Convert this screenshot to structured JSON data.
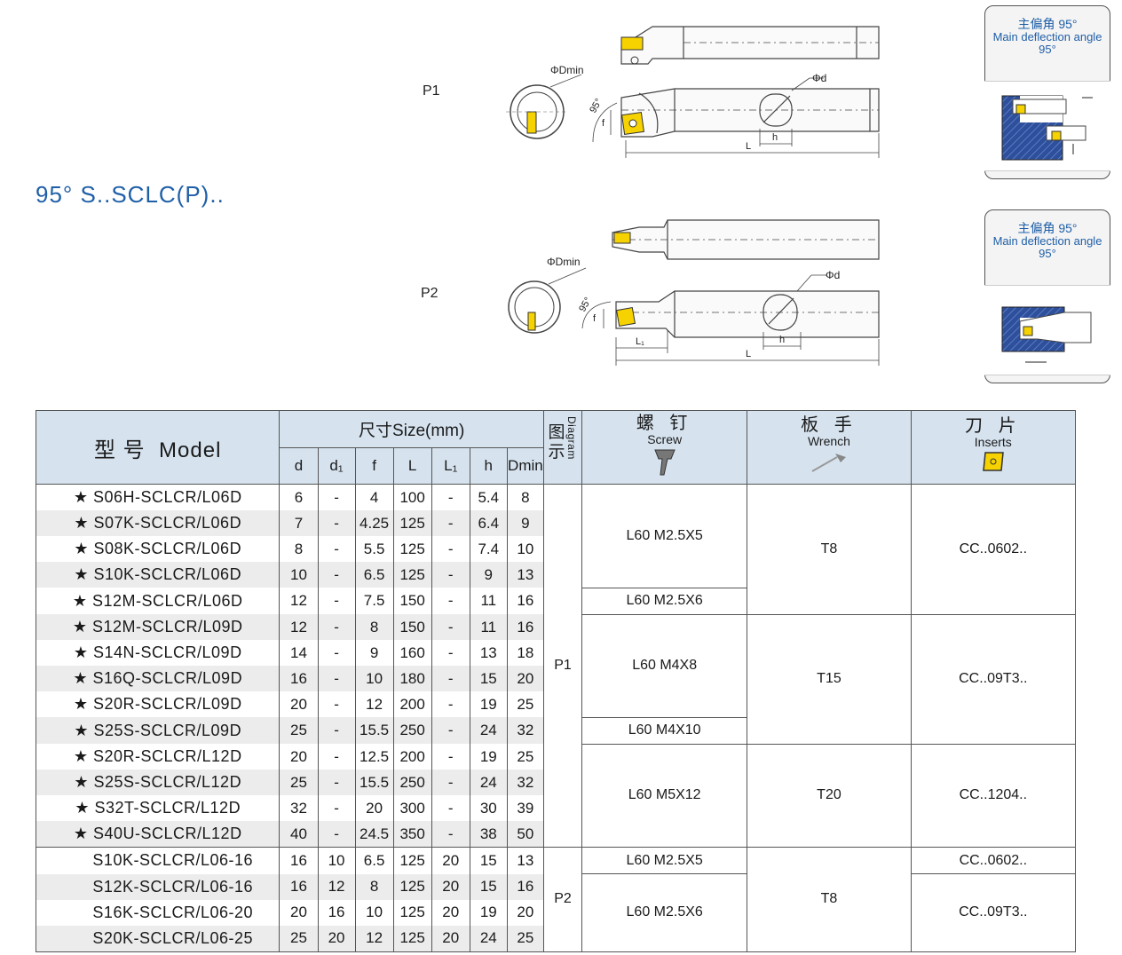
{
  "title": "95° S..SCLC(P)..",
  "diagrams": [
    {
      "label": "P1",
      "dmin": "ΦDmin",
      "d": "Φd",
      "angle": "95°",
      "f": "f",
      "h": "h",
      "L": "L"
    },
    {
      "label": "P2",
      "dmin": "ΦDmin",
      "d": "Φd",
      "angle": "95°",
      "f": "f",
      "h": "h",
      "L": "L",
      "L1": "L₁"
    }
  ],
  "info_boxes": [
    {
      "cn": "主偏角 95°",
      "en": "Main deflection angle 95°"
    },
    {
      "cn": "主偏角 95°",
      "en": "Main deflection angle 95°"
    }
  ],
  "table": {
    "header": {
      "model_cn": "型 号",
      "model_en": "Model",
      "size": "尺寸Size(mm)",
      "diagram_cn": "图示",
      "diagram_en": "Diagram",
      "screw_cn": "螺 钉",
      "screw_en": "Screw",
      "wrench_cn": "板 手",
      "wrench_en": "Wrench",
      "inserts_cn": "刀 片",
      "inserts_en": "Inserts",
      "cols": [
        "d",
        "d₁",
        "f",
        "L",
        "L₁",
        "h",
        "Dmin"
      ]
    },
    "rows": [
      {
        "model": "★ S06H-SCLCR/L06D",
        "d": "6",
        "d1": "-",
        "f": "4",
        "L": "100",
        "L1": "-",
        "h": "5.4",
        "dmin": "8"
      },
      {
        "model": "★ S07K-SCLCR/L06D",
        "d": "7",
        "d1": "-",
        "f": "4.25",
        "L": "125",
        "L1": "-",
        "h": "6.4",
        "dmin": "9"
      },
      {
        "model": "★ S08K-SCLCR/L06D",
        "d": "8",
        "d1": "-",
        "f": "5.5",
        "L": "125",
        "L1": "-",
        "h": "7.4",
        "dmin": "10"
      },
      {
        "model": "★ S10K-SCLCR/L06D",
        "d": "10",
        "d1": "-",
        "f": "6.5",
        "L": "125",
        "L1": "-",
        "h": "9",
        "dmin": "13"
      },
      {
        "model": "★ S12M-SCLCR/L06D",
        "d": "12",
        "d1": "-",
        "f": "7.5",
        "L": "150",
        "L1": "-",
        "h": "11",
        "dmin": "16"
      },
      {
        "model": "★ S12M-SCLCR/L09D",
        "d": "12",
        "d1": "-",
        "f": "8",
        "L": "150",
        "L1": "-",
        "h": "11",
        "dmin": "16"
      },
      {
        "model": "★ S14N-SCLCR/L09D",
        "d": "14",
        "d1": "-",
        "f": "9",
        "L": "160",
        "L1": "-",
        "h": "13",
        "dmin": "18"
      },
      {
        "model": "★ S16Q-SCLCR/L09D",
        "d": "16",
        "d1": "-",
        "f": "10",
        "L": "180",
        "L1": "-",
        "h": "15",
        "dmin": "20"
      },
      {
        "model": "★ S20R-SCLCR/L09D",
        "d": "20",
        "d1": "-",
        "f": "12",
        "L": "200",
        "L1": "-",
        "h": "19",
        "dmin": "25"
      },
      {
        "model": "★ S25S-SCLCR/L09D",
        "d": "25",
        "d1": "-",
        "f": "15.5",
        "L": "250",
        "L1": "-",
        "h": "24",
        "dmin": "32"
      },
      {
        "model": "★ S20R-SCLCR/L12D",
        "d": "20",
        "d1": "-",
        "f": "12.5",
        "L": "200",
        "L1": "-",
        "h": "19",
        "dmin": "25"
      },
      {
        "model": "★ S25S-SCLCR/L12D",
        "d": "25",
        "d1": "-",
        "f": "15.5",
        "L": "250",
        "L1": "-",
        "h": "24",
        "dmin": "32"
      },
      {
        "model": "★ S32T-SCLCR/L12D",
        "d": "32",
        "d1": "-",
        "f": "20",
        "L": "300",
        "L1": "-",
        "h": "30",
        "dmin": "39"
      },
      {
        "model": "★ S40U-SCLCR/L12D",
        "d": "40",
        "d1": "-",
        "f": "24.5",
        "L": "350",
        "L1": "-",
        "h": "38",
        "dmin": "50"
      },
      {
        "model": "S10K-SCLCR/L06-16",
        "d": "16",
        "d1": "10",
        "f": "6.5",
        "L": "125",
        "L1": "20",
        "h": "15",
        "dmin": "13"
      },
      {
        "model": "S12K-SCLCR/L06-16",
        "d": "16",
        "d1": "12",
        "f": "8",
        "L": "125",
        "L1": "20",
        "h": "15",
        "dmin": "16"
      },
      {
        "model": "S16K-SCLCR/L06-20",
        "d": "20",
        "d1": "16",
        "f": "10",
        "L": "125",
        "L1": "20",
        "h": "19",
        "dmin": "20"
      },
      {
        "model": "S20K-SCLCR/L06-25",
        "d": "25",
        "d1": "20",
        "f": "12",
        "L": "125",
        "L1": "20",
        "h": "24",
        "dmin": "25"
      }
    ],
    "diagram_groups": [
      "P1",
      "P2"
    ],
    "screws": [
      "L60 M2.5X5",
      "L60 M2.5X6",
      "L60 M4X8",
      "L60 M4X10",
      "L60 M5X12",
      "L60 M2.5X5",
      "L60 M2.5X6"
    ],
    "wrenches": [
      "T8",
      "T15",
      "T20",
      "T8"
    ],
    "inserts": [
      "CC..0602..",
      "CC..09T3..",
      "CC..1204..",
      "CC..0602..",
      "CC..09T3.."
    ]
  },
  "colors": {
    "title_blue": "#1f5fa8",
    "header_bg": "#d6e3ef",
    "row_shade": "#ececec",
    "insert_yellow": "#f5d200"
  }
}
